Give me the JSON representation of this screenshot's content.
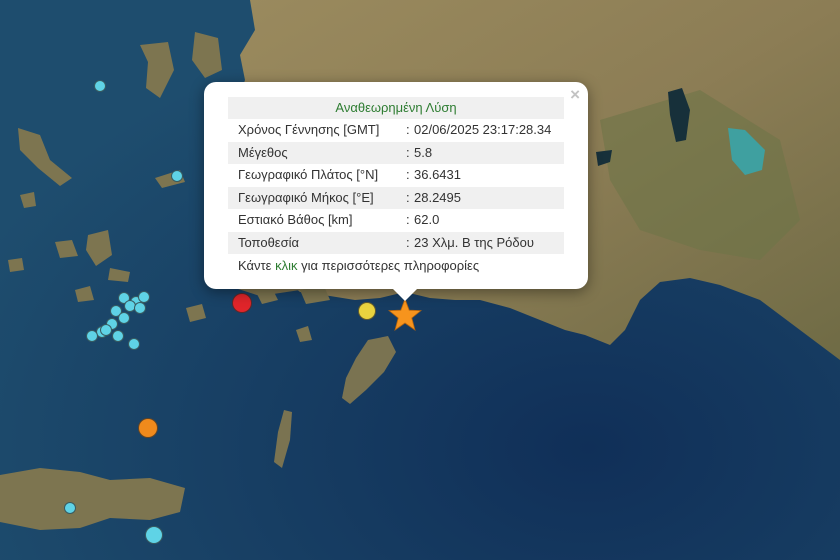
{
  "popup": {
    "title": "Αναθεωρημένη Λύση",
    "rows": [
      {
        "label": "Χρόνος Γέννησης [GMT]",
        "value": "02/06/2025 23:17:28.34"
      },
      {
        "label": "Μέγεθος",
        "value": "5.8"
      },
      {
        "label": "Γεωγραφικό Πλάτος [°N]",
        "value": "36.6431"
      },
      {
        "label": "Γεωγραφικό Μήκος [°E]",
        "value": "28.2495"
      },
      {
        "label": "Εστιακό Βάθος [km]",
        "value": "62.0"
      },
      {
        "label": "Τοποθεσία",
        "value": "23 Χλμ. Β της Ρόδου"
      }
    ],
    "separator": ":",
    "footer_prefix": "Κάντε",
    "footer_link": "κλικ",
    "footer_suffix": "για περισσότερες πληροφορίες",
    "close_label": "×"
  },
  "colors": {
    "sea": "#1c4a6b",
    "land": "#8a7a52",
    "marker_cyan": "#5fd3e6",
    "marker_red": "#e0252a",
    "marker_yellow": "#e9d33f",
    "marker_orange": "#f08a1c",
    "epicenter": "#f7941d"
  },
  "icons": {
    "epicenter": "star-icon",
    "close": "close-icon"
  }
}
